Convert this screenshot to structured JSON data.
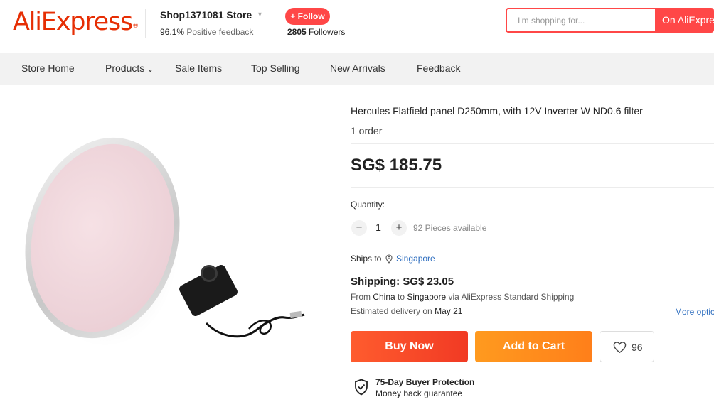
{
  "header": {
    "logo_text": "AliExpress",
    "logo_mark": "®",
    "store_name": "Shop1371081 Store",
    "feedback_percent": "96.1%",
    "feedback_label": "Positive feedback",
    "follow_label": "+ Follow",
    "followers_count": "2805",
    "followers_label": "Followers",
    "search_placeholder": "I'm shopping for...",
    "search_scope": "On AliExpress",
    "brand_color": "#e62e04",
    "accent_color": "#ff4747"
  },
  "nav": {
    "items": [
      {
        "label": "Store Home"
      },
      {
        "label": "Products",
        "has_dropdown": true
      },
      {
        "label": "Sale Items"
      },
      {
        "label": "Top Selling"
      },
      {
        "label": "New Arrivals"
      },
      {
        "label": "Feedback"
      }
    ]
  },
  "product": {
    "title": "Hercules Flatfield panel D250mm, with 12V Inverter W ND0.6 filter",
    "orders": "1 order",
    "price": "SG$ 185.75",
    "quantity_label": "Quantity:",
    "quantity_value": "1",
    "quantity_minus": "−",
    "quantity_plus": "+",
    "pieces_available": "92 Pieces available",
    "ships_to_label": "Ships to",
    "ships_to_country": "Singapore",
    "shipping_label": "Shipping: SG$ 23.05",
    "shipping_route": {
      "prefix": "From",
      "from": "China",
      "to_word": "to",
      "to": "Singapore",
      "via": "via AliExpress Standard Shipping"
    },
    "delivery_prefix": "Estimated delivery on",
    "delivery_date": "May 21",
    "more_options": "More options",
    "buy_now": "Buy Now",
    "add_to_cart": "Add to Cart",
    "wishlist_count": "96",
    "protection_title": "75-Day Buyer Protection",
    "protection_sub": "Money back guarantee"
  }
}
